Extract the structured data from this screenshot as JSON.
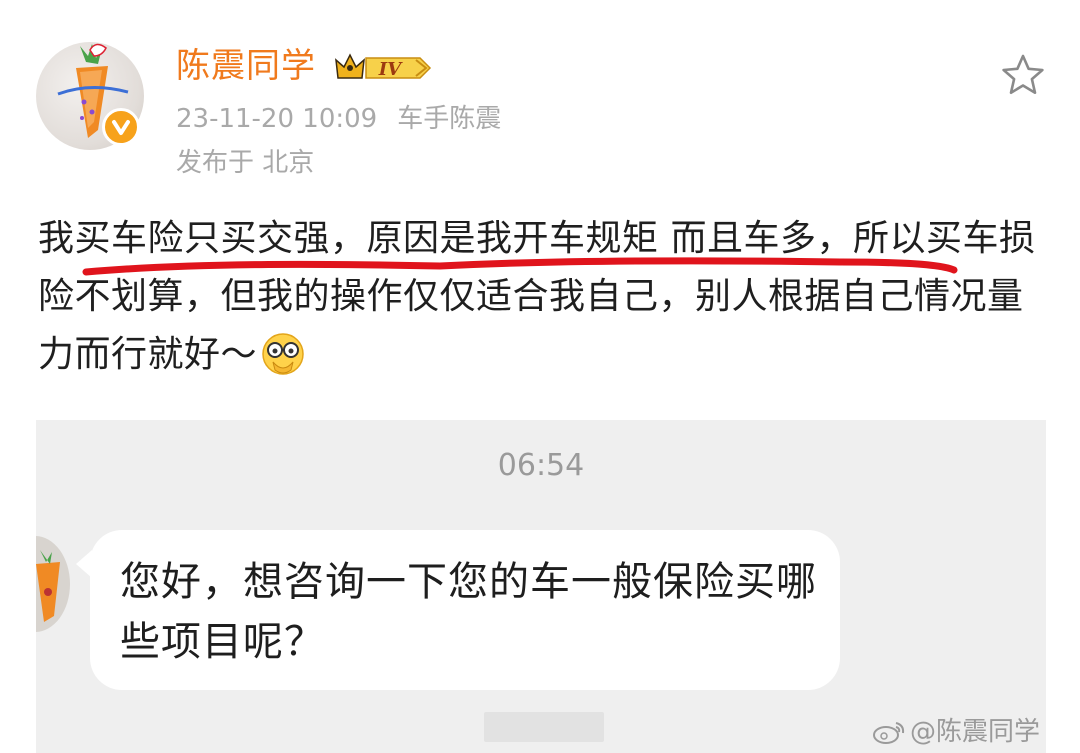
{
  "post": {
    "author": {
      "username": "陈震同学",
      "level": "IV",
      "verified": true
    },
    "meta": {
      "date": "23-11-20 10:09",
      "source": "车手陈震",
      "location": "发布于 北京"
    },
    "body": "我买车险只买交强，原因是我开车规矩 而且车多，所以买车损险不划算，但我的操作仅仅适合我自己，别人根据自己情况量力而行就好～",
    "emoji": "facepalm-emoji"
  },
  "screenshot": {
    "time": "06:54",
    "message": "您好，想咨询一下您的车一般保险买哪些项目呢？"
  },
  "watermark": {
    "text": "@陈震同学"
  },
  "colors": {
    "username": "#f07a1d",
    "meta": "#a9a9a9",
    "underline": "#e0141c",
    "chat_bg": "#efefef"
  },
  "icons": {
    "star": "star-outline-icon",
    "verified": "verified-badge-icon",
    "level": "crown-level-icon",
    "weibo": "weibo-logo-icon"
  }
}
